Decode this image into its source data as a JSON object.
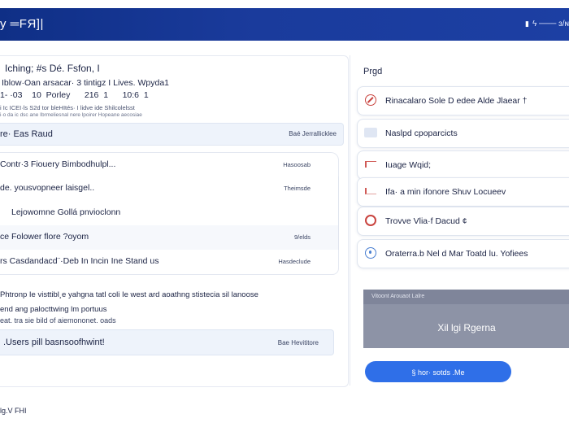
{
  "header": {
    "brand": "y ═FЯ]|",
    "right_label": "ϟ ─── ɜ/ɴ"
  },
  "left": {
    "info": {
      "title": "Iching; #s Dé. Fsfon, I",
      "line1": "Iblow·Oan arsacar·  3 tintigz  I Lives.  Wpyda1",
      "line2": "1- ·03    10  Porley      216  1      10:6  1",
      "line3": "i  Ic  ICEI·ls  S2d  tor  bleHItés·  I lidve ide Shilcolelsst",
      "line4": "i·o  da ic  dsc ane               Ibrmeliesnal  nere lpoirer  Hopeane aecosiae"
    },
    "section": {
      "label": "re· Eas Raud",
      "action": "Baé Jerrallicklee"
    },
    "rows": [
      {
        "text": "Contr·3 Fiouery Bimbodhulpl...",
        "value": "Hasoosab"
      },
      {
        "text": "de. yousvopneer laisgel..",
        "value": "Theimsde"
      },
      {
        "text": "Lejowomne  Gollá pnvioclonn",
        "value": ""
      },
      {
        "text": "ce  Folower flore  ?oyom",
        "value": "9/elds"
      },
      {
        "text": "rs   Casdandacd¨·Deb In  Incin  Ine  Stand us",
        "value": "Hasdeclude"
      }
    ],
    "desc": {
      "line1": "Phtronp Ie visttibl¸e yahgna tatl coli Ie west ard aoathng stistecia sil lanoose",
      "line2": "end ang palocttwing lm portuus",
      "line3": "eat. tra sie bild of aiemononet. oads"
    },
    "note": {
      "label": ".Users  pill basnsoofhwint!",
      "action": "Bae Hevititore"
    }
  },
  "right": {
    "title": "Prgd",
    "actions": [
      {
        "icon": "no-entry-icon",
        "label": "Rinacalaro Sole D edee   Alde Jlaear †"
      },
      {
        "icon": "tag-icon",
        "label": "Naslpd cpoparcicts"
      },
      {
        "icon": "flag-icon",
        "label": "Iuage Wqid;"
      },
      {
        "icon": "flag-icon",
        "label": "Ifa· a min ifonore  Shuv Locueev"
      },
      {
        "icon": "refresh-icon",
        "label": "Trovve  Vlia·f Dacud ¢"
      },
      {
        "icon": "info-icon",
        "label": "Oraterra.b Nel d  Mar  Toatd lu.  Yofiees"
      }
    ],
    "preview": {
      "caption": "Vitoont Arouaot Lalre",
      "text": "Xil lgi  Rgerna"
    },
    "primary_button": "§  hor· sotds .Me"
  },
  "footer": {
    "text": "lg.V FHI"
  },
  "colors": {
    "header": "#1a3b9c",
    "accent": "#2f6fe8",
    "danger": "#c9443f"
  }
}
